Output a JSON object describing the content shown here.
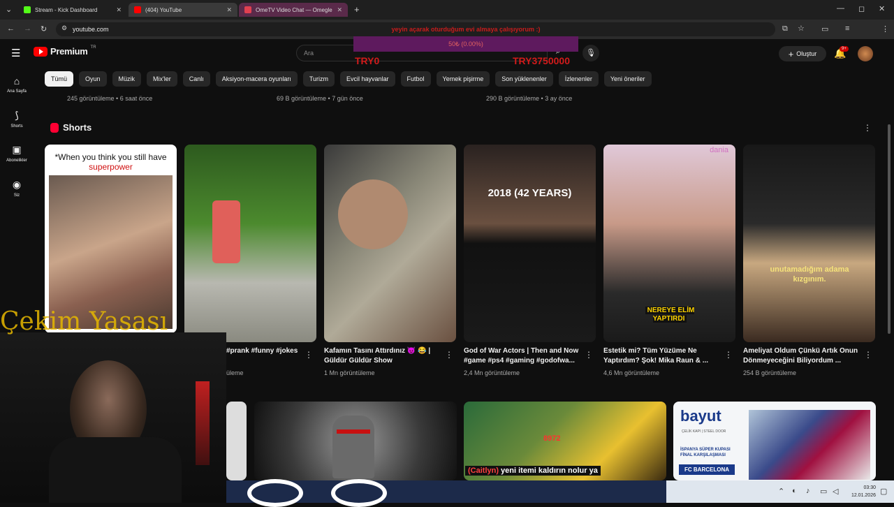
{
  "browser": {
    "tabs": [
      {
        "title": "Stream - Kick Dashboard",
        "favicon_color": "#53fc18"
      },
      {
        "title": "(404) YouTube",
        "favicon_color": "#ff0000"
      },
      {
        "title": "OmeTV Video Chat — Omegle",
        "favicon_color": "#e04050"
      }
    ],
    "url": "youtube.com",
    "new_tab_label": "+"
  },
  "overlay": {
    "marquee": "yeyin açarak oturduğum evi almaya çalışıyorum :)",
    "progress": "50₺ (0.00%)",
    "progress_fraction": 0.0,
    "try_left": "TRY0",
    "try_right": "TRY3750000"
  },
  "header": {
    "brand": "Premium",
    "region": "TR",
    "search_placeholder": "Ara",
    "create_label": "Oluştur",
    "notification_badge": "9+"
  },
  "sidebar": [
    {
      "label": "Ana Sayfa",
      "icon": "home-icon"
    },
    {
      "label": "Shorts",
      "icon": "shorts-icon"
    },
    {
      "label": "Abonelikler",
      "icon": "subscriptions-icon"
    },
    {
      "label": "Siz",
      "icon": "user-icon"
    }
  ],
  "chips": [
    "Tümü",
    "Oyun",
    "Müzik",
    "Mix'ler",
    "Canlı",
    "Aksiyon-macera oyunları",
    "Turizm",
    "Evcil hayvanlar",
    "Futbol",
    "Yemek pişirme",
    "Son yüklenenler",
    "İzlenenler",
    "Yeni öneriler"
  ],
  "prev_row_meta": [
    "245 görüntüleme • 6 saat önce",
    "69 B görüntüleme • 7 gün önce",
    "290 B görüntüleme • 3 ay önce"
  ],
  "shorts": {
    "section_title": "Shorts",
    "items": [
      {
        "title": "",
        "views": "",
        "overlay_text_1": "*When you think you still have ",
        "overlay_text_2": "superpower"
      },
      {
        "title": "#prank #funny #jokes",
        "views": "üleme"
      },
      {
        "title": "Kafamın Tasını Attırdınız 😈 😂 | Güldür Güldür Show",
        "views": "1 Mn görüntüleme"
      },
      {
        "title": "God of War Actors | Then and Now #game #ps4 #gaming #godofwa...",
        "views": "2,4 Mn görüntüleme",
        "overlay_text": "2018 (42 YEARS)"
      },
      {
        "title": "Estetik mi? Tüm Yüzüme Ne Yaptırdım? Şok! Mika Raun & ...",
        "views": "4,6 Mn görüntüleme",
        "overlay_text": "NEREYE ELİM YAPTIRDI",
        "corner_text": "dania"
      },
      {
        "title": "Ameliyat Oldum Çünkü Artık Onun Dönmeyeceğini Biliyordum ...",
        "views": "254 B görüntüleme",
        "overlay_text": "unutamadığım adama kızgınım."
      }
    ]
  },
  "lower_videos": [
    {
      "overlay": ""
    },
    {
      "overlay": "8972",
      "caption_highlight": "(Caitlyn)",
      "caption": " yeni itemi kaldırın nolur ya"
    },
    {
      "brand": "bayut",
      "brand_sub": "ÇELİK KAPI | STEEL DOOR",
      "promo_1": "İSPANYA SÜPER KUPASI",
      "promo_2": "FİNAL KARŞILAŞMASI",
      "team": "FC BARCELONA"
    }
  ],
  "stream_overlay": {
    "title": "Çekim Yasası"
  },
  "taskbar": {
    "time": "03:30",
    "date": "12.01.2026"
  }
}
